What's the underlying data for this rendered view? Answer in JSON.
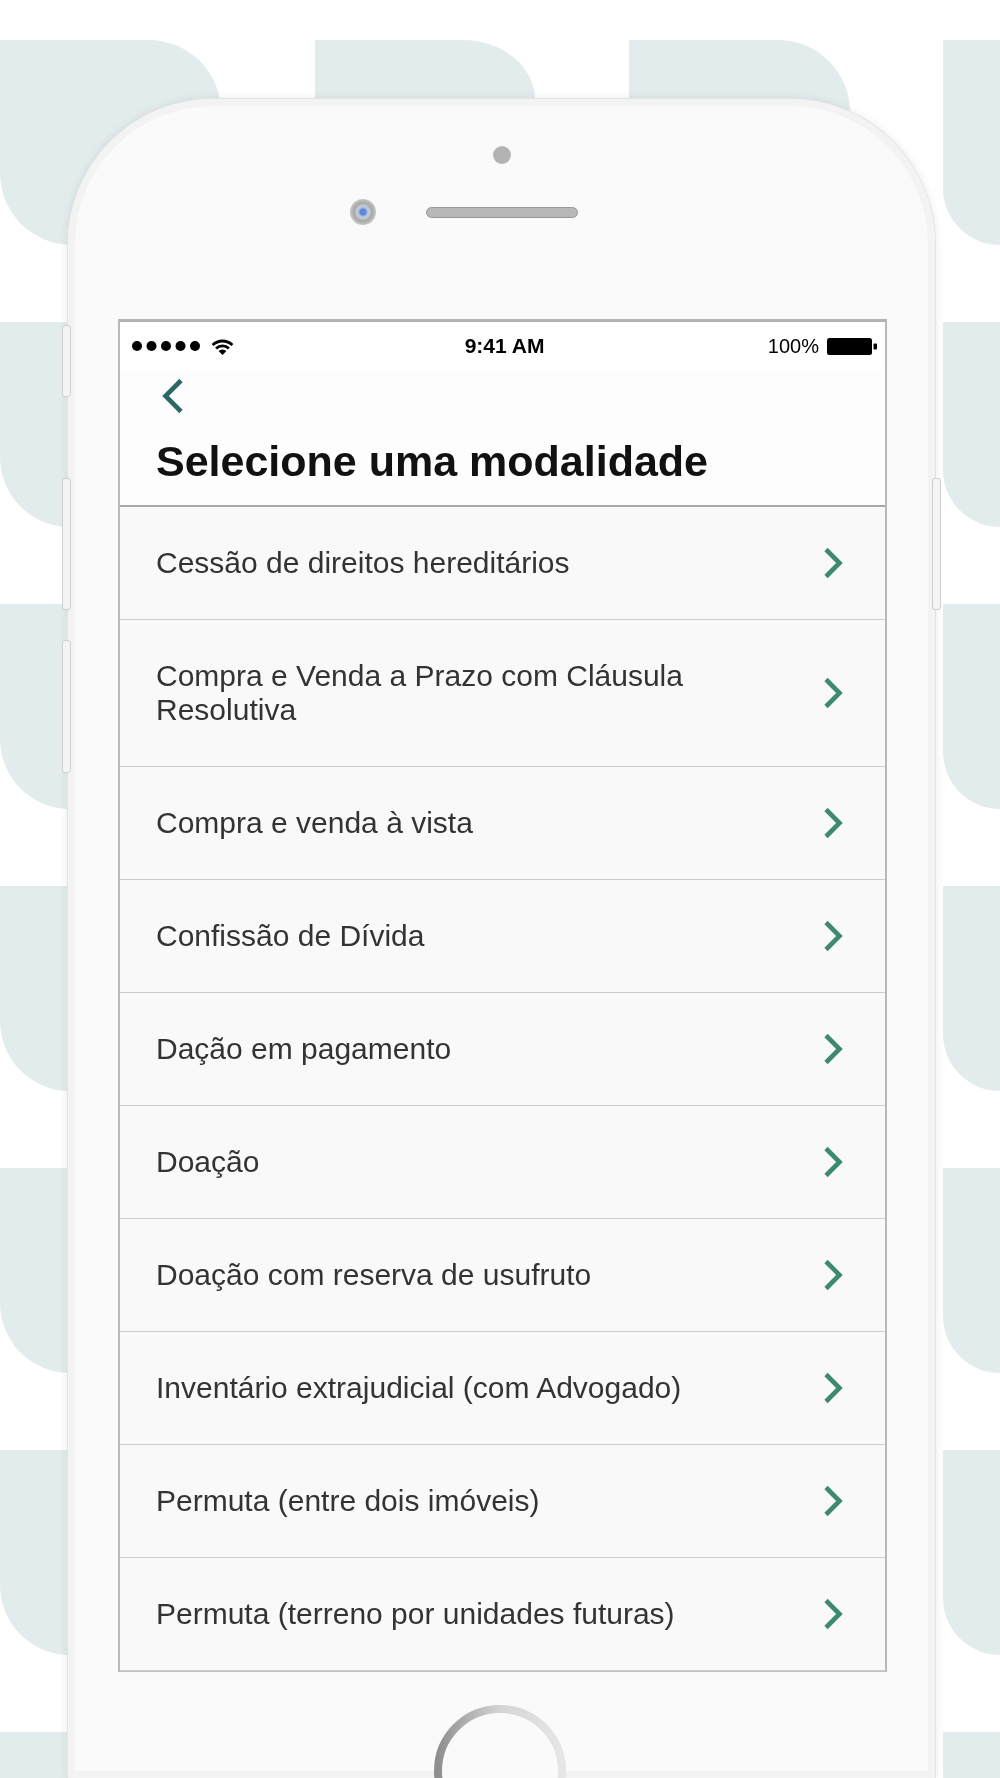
{
  "status_bar": {
    "time": "9:41 AM",
    "battery": "100%"
  },
  "header": {
    "title": "Selecione uma modalidade"
  },
  "modalidades": [
    {
      "label": "Cessão de direitos hereditários"
    },
    {
      "label": "Compra e Venda a Prazo com Cláusula Resolutiva"
    },
    {
      "label": "Compra e venda à vista"
    },
    {
      "label": "Confissão de Dívida"
    },
    {
      "label": "Dação em pagamento"
    },
    {
      "label": "Doação"
    },
    {
      "label": "Doação com reserva de usufruto"
    },
    {
      "label": "Inventário extrajudicial (com Advogado)"
    },
    {
      "label": "Permuta (entre dois imóveis)"
    },
    {
      "label": "Permuta (terreno por unidades futuras)"
    }
  ]
}
